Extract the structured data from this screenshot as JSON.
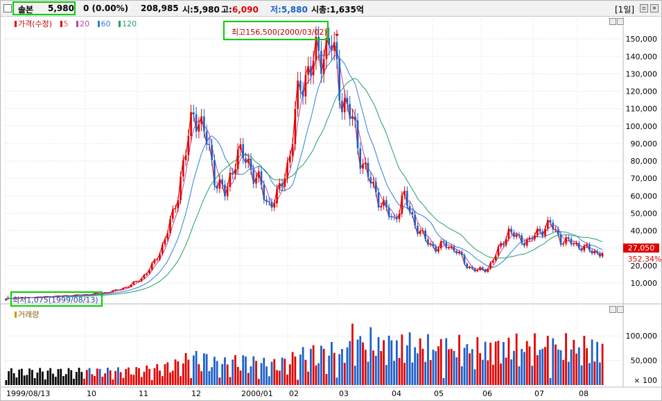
{
  "header": {
    "name": "솔본",
    "price": "5,980",
    "change": "0 (0.00%)",
    "volume": "208,985",
    "open": "시:5,980",
    "high_label": "고:",
    "high_value": "6,090",
    "low_label": "저:",
    "low_value": "5,880",
    "market_cap": "시총:1,635억",
    "period": "[1일]"
  },
  "legend": {
    "price_label": "가격(수정)",
    "ma5": "5",
    "ma20": "20",
    "ma60": "60",
    "ma120": "120",
    "volume_label": "거래량"
  },
  "annotations": {
    "high": "최고156,500(2000/03/02)",
    "low": "최저1,075(1999/08/13)",
    "current_price": "27,050",
    "current_pct": "352.34%"
  },
  "colors": {
    "up": "#e00000",
    "down": "#1c5fc8",
    "ma5": "#e00000",
    "ma20": "#c040a0",
    "ma60": "#2d7fd8",
    "ma120": "#20a060",
    "grid": "#d8d8d8",
    "highlight": "#00d000"
  },
  "chart_data": [
    {
      "type": "candlestick",
      "title": "",
      "x_tick_labels": [
        "1999/08/13",
        "10",
        "11",
        "12",
        "2000/01",
        "02",
        "03",
        "04",
        "05",
        "06",
        "07",
        "08"
      ],
      "y_tick_labels": [
        "10,000",
        "20,000",
        "30,000",
        "40,000",
        "50,000",
        "60,000",
        "70,000",
        "80,000",
        "90,000",
        "100,000",
        "110,000",
        "120,000",
        "130,000",
        "140,000",
        "150,000"
      ],
      "ylim": [
        0,
        160000
      ],
      "grid": true,
      "moving_averages": [
        5,
        20,
        60,
        120
      ],
      "close_approx": [
        1100,
        1300,
        1600,
        1900,
        2200,
        2500,
        2800,
        3100,
        3500,
        4000,
        5000,
        6500,
        9000,
        13000,
        20000,
        32000,
        50000,
        80000,
        110000,
        95000,
        70000,
        60000,
        85000,
        80000,
        70000,
        55000,
        60000,
        80000,
        120000,
        135000,
        140000,
        150000,
        118000,
        105000,
        80000,
        65000,
        55000,
        45000,
        60000,
        45000,
        35000,
        30000,
        32000,
        29000,
        20000,
        17000,
        18000,
        28000,
        40000,
        35000,
        34000,
        40000,
        44000,
        35000,
        33000,
        31000,
        28000,
        27050
      ],
      "high": 156500,
      "high_date": "2000/03/02",
      "low": 1075,
      "low_date": "1999/08/13",
      "last": 27050
    },
    {
      "type": "bar",
      "title": "거래량",
      "y_tick_labels": [
        "100,000",
        "50,000"
      ],
      "ylim": [
        0,
        130000
      ],
      "unit_label": "× 100"
    }
  ]
}
